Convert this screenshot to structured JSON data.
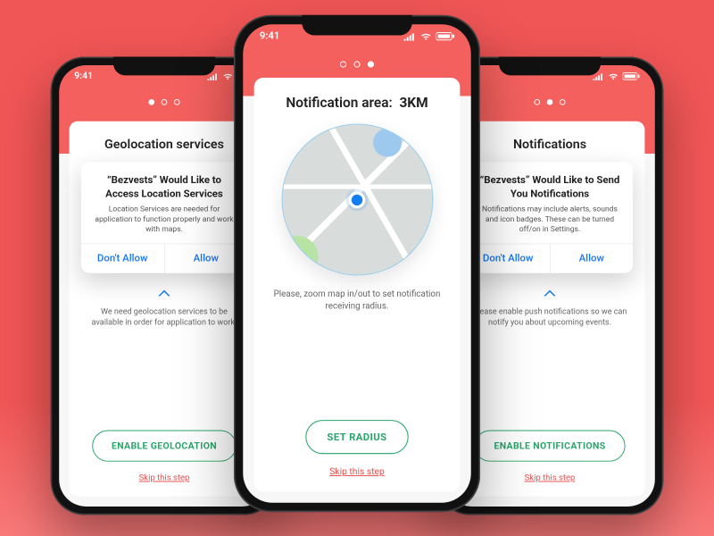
{
  "colors": {
    "accent": "#f15656",
    "cta": "#28a56a",
    "ios_blue": "#1478f5",
    "skip": "#e94e4e"
  },
  "status_time": "9:41",
  "skip_label": "Skip this step",
  "left": {
    "dots_active_index": 0,
    "title": "Geolocation services",
    "alert": {
      "title": "“Bezvests” Would Like to Access Location Services",
      "desc": "Location Services are needed for application to function properly and work with maps.",
      "deny": "Don't Allow",
      "allow": "Allow"
    },
    "body": "We need geolocation services to be available in order for application to work.",
    "cta": "ENABLE GEOLOCATION"
  },
  "center": {
    "dots_active_index": 2,
    "title_prefix": "Notification area:",
    "title_value": "3KM",
    "body": "Please, zoom map in/out to set notification receiving radius.",
    "cta": "SET RADIUS"
  },
  "right": {
    "dots_active_index": 1,
    "title": "Notifications",
    "alert": {
      "title": "“Bezvests” Would Like to Send You Notifications",
      "desc": "Notifications may include alerts, sounds and icon badges. These can be turned off/on in Settings.",
      "deny": "Don't Allow",
      "allow": "Allow"
    },
    "body": "Please enable push notifications so we can notify you about upcoming events.",
    "cta": "ENABLE NOTIFICATIONS"
  }
}
